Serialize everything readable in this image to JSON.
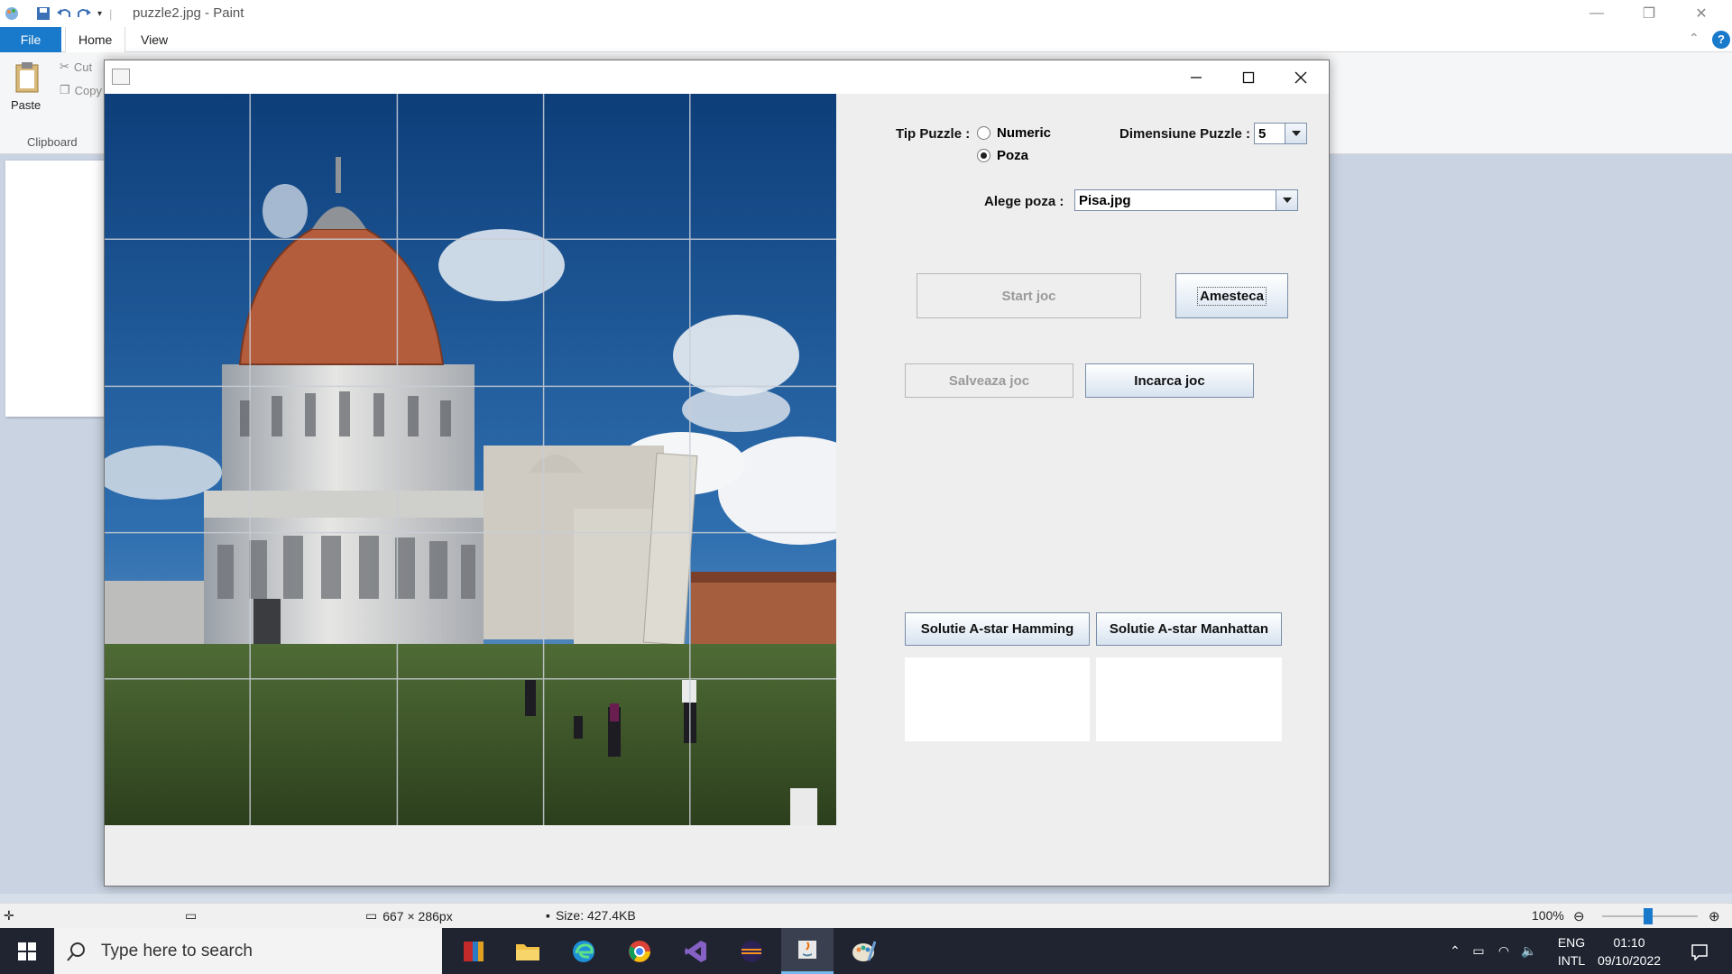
{
  "paint": {
    "title": "puzzle2.jpg - Paint",
    "tabs": [
      "File",
      "Home",
      "View"
    ],
    "ribbon": {
      "paste_label": "Paste",
      "cut_label": "Cut",
      "copy_label": "Copy",
      "clipboard_group": "Clipboard"
    },
    "status": {
      "dimensions": "667 × 286px",
      "size": "Size: 427.4KB",
      "zoom": "100%"
    }
  },
  "puzzle_window": {
    "tip_puzzle_label": "Tip Puzzle :",
    "radio_numeric": "Numeric",
    "radio_poza": "Poza",
    "selected_type": "Poza",
    "dimensiune_label": "Dimensiune Puzzle :",
    "dimensiune_value": "5",
    "alege_poza_label": "Alege poza :",
    "alege_poza_value": "Pisa.jpg",
    "buttons": {
      "start": "Start joc",
      "amesteca": "Amesteca",
      "salveaza": "Salveaza joc",
      "incarca": "Incarca joc",
      "hamming": "Solutie A-star Hamming",
      "manhattan": "Solutie A-star Manhattan"
    },
    "grid_size": 5
  },
  "taskbar": {
    "search_placeholder": "Type here to search",
    "lang_top": "ENG",
    "lang_bottom": "INTL",
    "time": "01:10",
    "date": "09/10/2022"
  },
  "colors": {
    "accent": "#1979ca",
    "taskbar": "#1f2430",
    "window_bg": "#eeeeee"
  }
}
